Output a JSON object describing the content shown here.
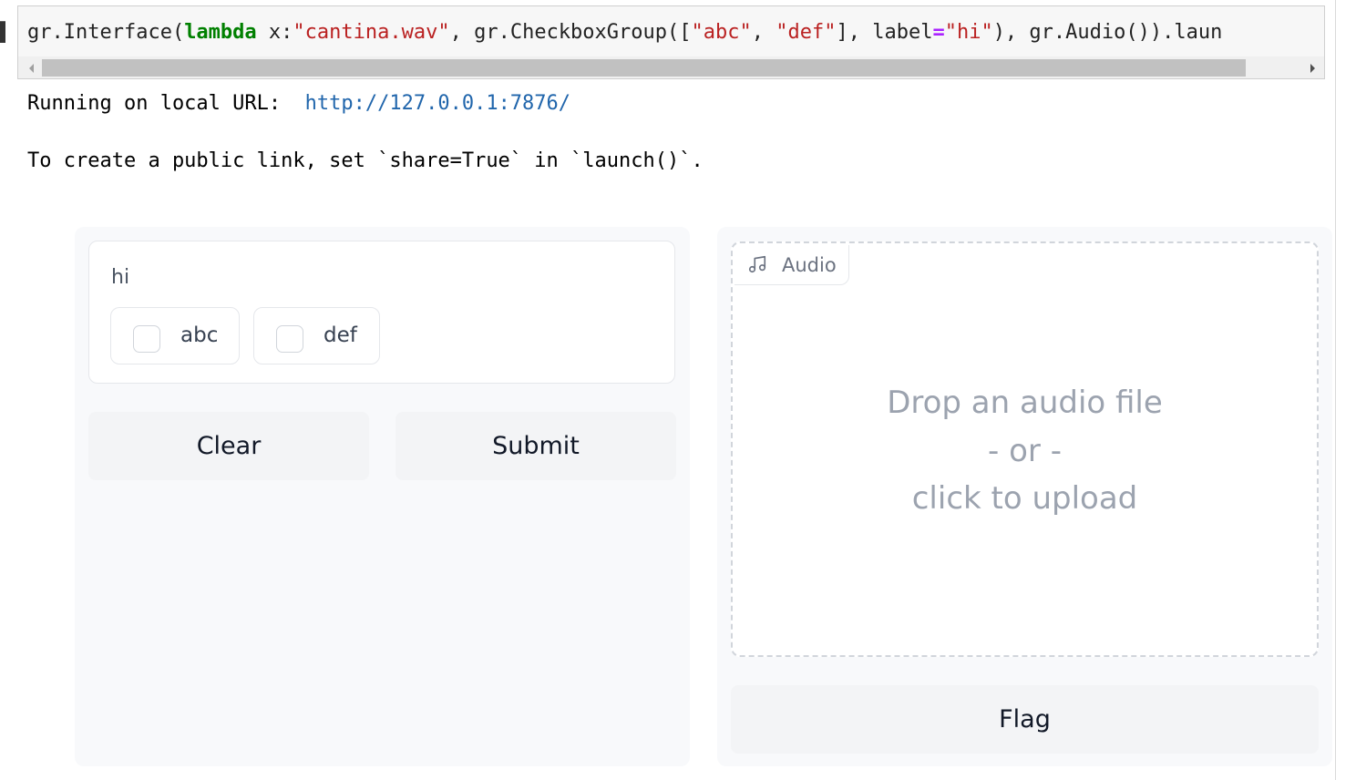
{
  "code_cell": {
    "tokens": [
      {
        "text": "gr.Interface(",
        "kind": "plain"
      },
      {
        "text": "lambda",
        "kind": "keyword"
      },
      {
        "text": " x:",
        "kind": "plain"
      },
      {
        "text": "\"cantina.wav\"",
        "kind": "string"
      },
      {
        "text": ", gr.CheckboxGroup([",
        "kind": "plain"
      },
      {
        "text": "\"abc\"",
        "kind": "string"
      },
      {
        "text": ", ",
        "kind": "plain"
      },
      {
        "text": "\"def\"",
        "kind": "string"
      },
      {
        "text": "], label",
        "kind": "plain"
      },
      {
        "text": "=",
        "kind": "operator"
      },
      {
        "text": "\"hi\"",
        "kind": "string"
      },
      {
        "text": "), gr.Audio()).laun",
        "kind": "plain"
      }
    ]
  },
  "output": {
    "running_prefix": "Running on local URL:  ",
    "local_url": "http://127.0.0.1:7876/",
    "share_hint": "To create a public link, set `share=True` in `launch()`."
  },
  "app": {
    "checkbox_group": {
      "label": "hi",
      "options": [
        "abc",
        "def"
      ]
    },
    "buttons": {
      "clear": "Clear",
      "submit": "Submit",
      "flag": "Flag"
    },
    "audio": {
      "label": "Audio",
      "icon": "music-note-icon",
      "drop_line1": "Drop an audio file",
      "drop_line2": "- or -",
      "drop_line3": "click to upload"
    }
  },
  "colors": {
    "keyword": "#008000",
    "string": "#ba2121",
    "operator": "#aa22ff",
    "url": "#2166ac"
  }
}
